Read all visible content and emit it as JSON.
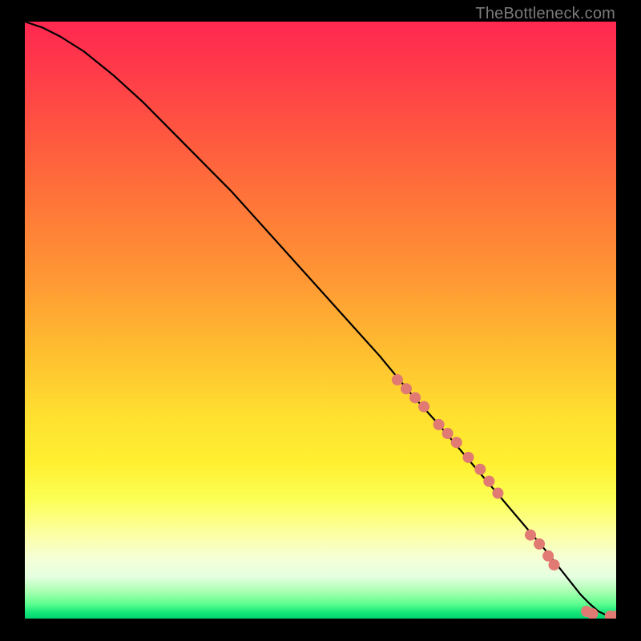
{
  "attribution": "TheBottleneck.com",
  "chart_data": {
    "type": "line",
    "title": "",
    "xlabel": "",
    "ylabel": "",
    "xlim": [
      0,
      100
    ],
    "ylim": [
      0,
      100
    ],
    "gradient_direction": "top-red-to-bottom-green",
    "series": [
      {
        "name": "curve",
        "x": [
          0,
          3,
          6,
          10,
          15,
          20,
          25,
          30,
          35,
          40,
          45,
          50,
          55,
          60,
          65,
          70,
          73,
          76,
          79,
          82,
          85,
          88,
          90,
          92,
          94,
          95.5,
          97,
          98.5,
          100
        ],
        "y": [
          100,
          99,
          97.5,
          95,
          91,
          86.5,
          81.5,
          76.5,
          71.5,
          66,
          60.5,
          55,
          49.5,
          44,
          38,
          32.5,
          29,
          25.5,
          22,
          18.5,
          15,
          11.5,
          9,
          6.5,
          4,
          2.5,
          1.2,
          0.5,
          0.3
        ]
      }
    ],
    "markers": {
      "name": "dots",
      "color": "#e07a72",
      "radius": 7,
      "points": [
        {
          "x": 63,
          "y": 40
        },
        {
          "x": 64.5,
          "y": 38.5
        },
        {
          "x": 66,
          "y": 37
        },
        {
          "x": 67.5,
          "y": 35.5
        },
        {
          "x": 70,
          "y": 32.5
        },
        {
          "x": 71.5,
          "y": 31
        },
        {
          "x": 73,
          "y": 29.5
        },
        {
          "x": 75,
          "y": 27
        },
        {
          "x": 77,
          "y": 25
        },
        {
          "x": 78.5,
          "y": 23
        },
        {
          "x": 80,
          "y": 21
        },
        {
          "x": 85.5,
          "y": 14
        },
        {
          "x": 87,
          "y": 12.5
        },
        {
          "x": 88.5,
          "y": 10.5
        },
        {
          "x": 89.5,
          "y": 9
        },
        {
          "x": 95,
          "y": 1.2
        },
        {
          "x": 96,
          "y": 0.8
        },
        {
          "x": 99,
          "y": 0.4
        },
        {
          "x": 100,
          "y": 0.4
        }
      ]
    }
  }
}
